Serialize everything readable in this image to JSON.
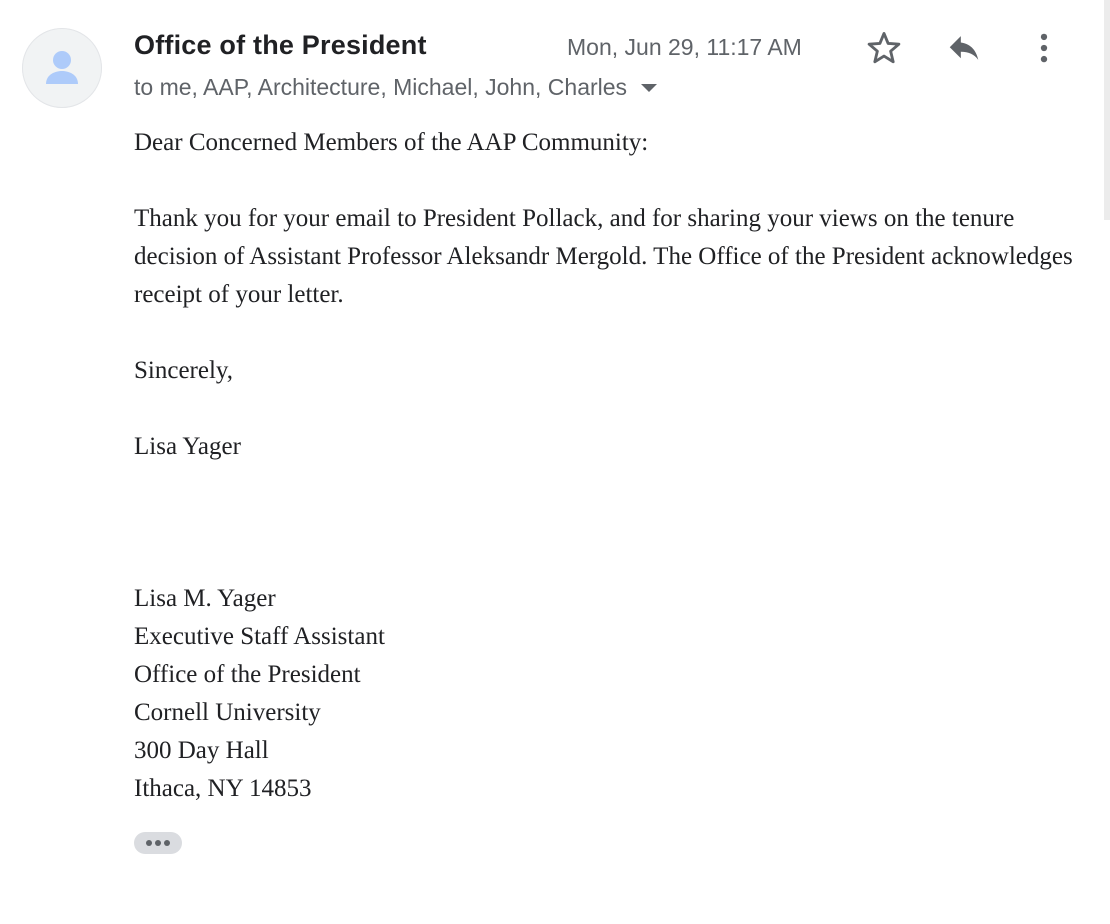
{
  "header": {
    "sender": "Office of the President",
    "recipients": "to me, AAP, Architecture, Michael, John, Charles",
    "date": "Mon, Jun 29, 11:17 AM",
    "icons": {
      "avatar": "person-icon",
      "star": "star-icon",
      "reply": "reply-icon",
      "more": "more-vert-icon",
      "recipients_toggle": "chevron-down-icon"
    }
  },
  "message": {
    "greeting": "Dear Concerned Members of the AAP Community:",
    "paragraph": "Thank you for your email to President Pollack, and for sharing your views on the tenure decision of Assistant Professor Aleksandr Mergold. The Office of the President acknowledges receipt of your letter.",
    "closing": "Sincerely,",
    "name": "Lisa Yager",
    "signature": {
      "line1": "Lisa M. Yager",
      "line2": "Executive Staff Assistant",
      "line3": "Office of the President",
      "line4": "Cornell University",
      "line5": "300 Day Hall",
      "line6": "Ithaca, NY 14853"
    }
  },
  "colors": {
    "text_primary": "#202124",
    "text_secondary": "#5f6368",
    "avatar_bg": "#f1f3f4",
    "avatar_icon": "#aecbfa"
  }
}
